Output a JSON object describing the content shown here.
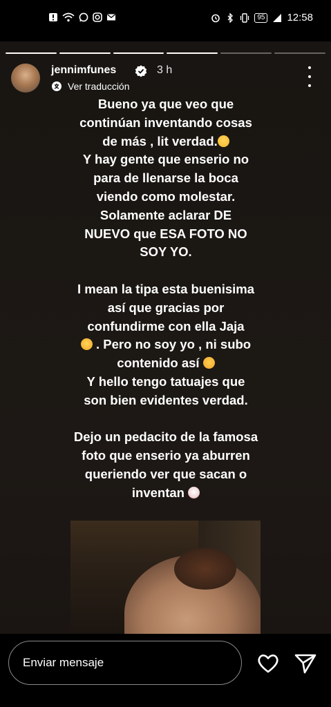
{
  "status_bar": {
    "time": "12:58",
    "battery": "95",
    "left_icons": [
      "alert-icon",
      "wifi-icon",
      "whatsapp-icon",
      "instagram-icon",
      "mail-icon"
    ],
    "right_icons": [
      "alarm-icon",
      "bluetooth-icon",
      "vibrate-icon",
      "battery-icon",
      "signal-icon"
    ]
  },
  "story_progress": {
    "segments": 6,
    "completed": 4
  },
  "header": {
    "username": "jennimfunes",
    "time_ago": "3 h",
    "translate_label": "Ver traducción"
  },
  "story_text": {
    "para1": [
      "Bueno ya que veo que",
      "continúan inventando cosas",
      "de más , lit verdad.",
      "Y hay gente que enserio no",
      "para de llenarse la boca",
      "viendo como molestar.",
      "Solamente aclarar DE",
      "NUEVO que ESA FOTO NO",
      "SOY YO."
    ],
    "para2": [
      "I mean la tipa esta buenisima",
      "así  que gracias por",
      "confundirme con ella Jaja",
      ". Pero no soy yo , ni subo",
      "contenido así",
      "Y hello tengo tatuajes que",
      "son bien evidentes verdad."
    ],
    "para3": [
      "Dejo un pedacito de la famosa",
      "foto que enserio ya aburren",
      "queriendo ver que sacan o",
      "inventan"
    ]
  },
  "composer": {
    "placeholder": "Enviar mensaje"
  },
  "colors": {
    "background": "#000000",
    "story_bg": "#1b1713",
    "text": "#ffffff",
    "input_border": "#8a8a8a"
  }
}
